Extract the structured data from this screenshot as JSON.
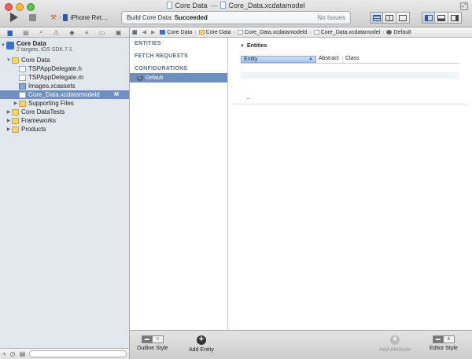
{
  "window": {
    "title_project": "Core Data",
    "title_sep": "—",
    "title_file": "Core_Data.xcdatamodel"
  },
  "toolbar": {
    "scheme_device": "iPhone Ret…",
    "activity_label": "Build Core Data:",
    "activity_status": "Succeeded",
    "issues": "No Issues"
  },
  "navigator": {
    "project_name": "Core Data",
    "project_sub": "2 targets, iOS SDK 7.1",
    "items": [
      {
        "label": "Core Data",
        "type": "folder",
        "indent": 1,
        "disc": "▼"
      },
      {
        "label": "TSPAppDelegate.h",
        "type": "file",
        "indent": 2,
        "disc": ""
      },
      {
        "label": "TSPAppDelegate.m",
        "type": "file",
        "indent": 2,
        "disc": ""
      },
      {
        "label": "Images.xcassets",
        "type": "assets",
        "indent": 2,
        "disc": ""
      },
      {
        "label": "Core_Data.xcdatamodeld",
        "type": "file",
        "indent": 2,
        "disc": "",
        "selected": true,
        "badge": "M"
      },
      {
        "label": "Supporting Files",
        "type": "folder",
        "indent": 2,
        "disc": "▶"
      },
      {
        "label": "Core DataTests",
        "type": "folder",
        "indent": 1,
        "disc": "▶"
      },
      {
        "label": "Frameworks",
        "type": "folder",
        "indent": 1,
        "disc": "▶"
      },
      {
        "label": "Products",
        "type": "folder",
        "indent": 1,
        "disc": "▶"
      }
    ]
  },
  "jumpbar": {
    "crumbs": [
      "Core Data",
      "Core Data",
      "Core_Data.xcdatamodeld",
      "Core_Data.xcdatamodel",
      "Default"
    ]
  },
  "model": {
    "entities_header": "ENTITIES",
    "fetch_header": "FETCH REQUESTS",
    "config_header": "CONFIGURATIONS",
    "config_default": "Default"
  },
  "editor": {
    "section": "Entities",
    "col_entity": "Entity",
    "col_abstract": "Abstract",
    "col_class": "Class",
    "add_minus": "–"
  },
  "bottombar": {
    "outline_style": "Outline Style",
    "add_entity": "Add Entity",
    "add_attribute": "Add Attribute",
    "editor_style": "Editor Style"
  }
}
